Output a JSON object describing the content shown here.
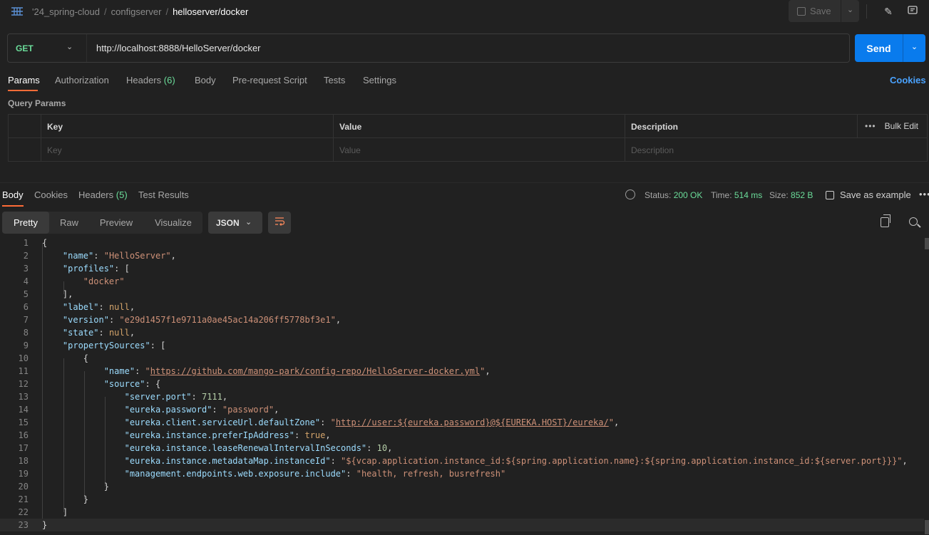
{
  "breadcrumb": {
    "items": [
      "'24_spring-cloud",
      "configserver"
    ],
    "current": "helloserver/docker"
  },
  "toolbar": {
    "save_label": "Save",
    "icons": [
      "edit-icon",
      "comment-icon"
    ]
  },
  "request": {
    "method": "GET",
    "url": "http://localhost:8888/HelloServer/docker",
    "send_label": "Send"
  },
  "request_tabs": [
    {
      "label": "Params",
      "active": true
    },
    {
      "label": "Authorization"
    },
    {
      "label": "Headers",
      "count": "(6)"
    },
    {
      "label": "Body"
    },
    {
      "label": "Pre-request Script"
    },
    {
      "label": "Tests"
    },
    {
      "label": "Settings"
    }
  ],
  "cookies_label": "Cookies",
  "query_params": {
    "title": "Query Params",
    "headers": [
      "Key",
      "Value",
      "Description"
    ],
    "bulk_edit": "Bulk Edit",
    "placeholders": [
      "Key",
      "Value",
      "Description"
    ]
  },
  "response_tabs": [
    {
      "label": "Body",
      "active": true
    },
    {
      "label": "Cookies"
    },
    {
      "label": "Headers",
      "count": "(5)"
    },
    {
      "label": "Test Results"
    }
  ],
  "response_meta": {
    "status_label": "Status:",
    "status_value": "200 OK",
    "time_label": "Time:",
    "time_value": "514 ms",
    "size_label": "Size:",
    "size_value": "852 B",
    "save_example": "Save as example"
  },
  "format_tabs": [
    "Pretty",
    "Raw",
    "Preview",
    "Visualize"
  ],
  "language": "JSON",
  "colors": {
    "accent": "#ff6c37",
    "send": "#097bed",
    "success": "#6bdd9a",
    "link": "#4aa3ff"
  },
  "code_lines": [
    [
      [
        "p",
        "{"
      ]
    ],
    [
      [
        "p",
        "    "
      ],
      [
        "k",
        "\"name\""
      ],
      [
        "p",
        ": "
      ],
      [
        "s",
        "\"HelloServer\""
      ],
      [
        "p",
        ","
      ]
    ],
    [
      [
        "p",
        "    "
      ],
      [
        "k",
        "\"profiles\""
      ],
      [
        "p",
        ": ["
      ]
    ],
    [
      [
        "p",
        "        "
      ],
      [
        "s",
        "\"docker\""
      ]
    ],
    [
      [
        "p",
        "    ],"
      ]
    ],
    [
      [
        "p",
        "    "
      ],
      [
        "k",
        "\"label\""
      ],
      [
        "p",
        ": "
      ],
      [
        "kw",
        "null"
      ],
      [
        "p",
        ","
      ]
    ],
    [
      [
        "p",
        "    "
      ],
      [
        "k",
        "\"version\""
      ],
      [
        "p",
        ": "
      ],
      [
        "s",
        "\"e29d1457f1e9711a0ae45ac14a206ff5778bf3e1\""
      ],
      [
        "p",
        ","
      ]
    ],
    [
      [
        "p",
        "    "
      ],
      [
        "k",
        "\"state\""
      ],
      [
        "p",
        ": "
      ],
      [
        "kw",
        "null"
      ],
      [
        "p",
        ","
      ]
    ],
    [
      [
        "p",
        "    "
      ],
      [
        "k",
        "\"propertySources\""
      ],
      [
        "p",
        ": ["
      ]
    ],
    [
      [
        "p",
        "        {"
      ]
    ],
    [
      [
        "p",
        "            "
      ],
      [
        "k",
        "\"name\""
      ],
      [
        "p",
        ": "
      ],
      [
        "s",
        "\""
      ],
      [
        "u",
        "https://github.com/mango-park/config-repo/HelloServer-docker.yml"
      ],
      [
        "s",
        "\""
      ],
      [
        "p",
        ","
      ]
    ],
    [
      [
        "p",
        "            "
      ],
      [
        "k",
        "\"source\""
      ],
      [
        "p",
        ": {"
      ]
    ],
    [
      [
        "p",
        "                "
      ],
      [
        "k",
        "\"server.port\""
      ],
      [
        "p",
        ": "
      ],
      [
        "n",
        "7111"
      ],
      [
        "p",
        ","
      ]
    ],
    [
      [
        "p",
        "                "
      ],
      [
        "k",
        "\"eureka.password\""
      ],
      [
        "p",
        ": "
      ],
      [
        "s",
        "\"password\""
      ],
      [
        "p",
        ","
      ]
    ],
    [
      [
        "p",
        "                "
      ],
      [
        "k",
        "\"eureka.client.serviceUrl.defaultZone\""
      ],
      [
        "p",
        ": "
      ],
      [
        "s",
        "\""
      ],
      [
        "u",
        "http://user:${eureka.password}@${EUREKA.HOST}/eureka/"
      ],
      [
        "s",
        "\""
      ],
      [
        "p",
        ","
      ]
    ],
    [
      [
        "p",
        "                "
      ],
      [
        "k",
        "\"eureka.instance.preferIpAddress\""
      ],
      [
        "p",
        ": "
      ],
      [
        "kw",
        "true"
      ],
      [
        "p",
        ","
      ]
    ],
    [
      [
        "p",
        "                "
      ],
      [
        "k",
        "\"eureka.instance.leaseRenewalIntervalInSeconds\""
      ],
      [
        "p",
        ": "
      ],
      [
        "n",
        "10"
      ],
      [
        "p",
        ","
      ]
    ],
    [
      [
        "p",
        "                "
      ],
      [
        "k",
        "\"eureka.instance.metadataMap.instanceId\""
      ],
      [
        "p",
        ": "
      ],
      [
        "s",
        "\"${vcap.application.instance_id:${spring.application.name}:${spring.application.instance_id:${server.port}}}\""
      ],
      [
        "p",
        ","
      ]
    ],
    [
      [
        "p",
        "                "
      ],
      [
        "k",
        "\"management.endpoints.web.exposure.include\""
      ],
      [
        "p",
        ": "
      ],
      [
        "s",
        "\"health, refresh, busrefresh\""
      ]
    ],
    [
      [
        "p",
        "            }"
      ]
    ],
    [
      [
        "p",
        "        }"
      ]
    ],
    [
      [
        "p",
        "    ]"
      ]
    ],
    [
      [
        "p",
        "}"
      ]
    ]
  ]
}
